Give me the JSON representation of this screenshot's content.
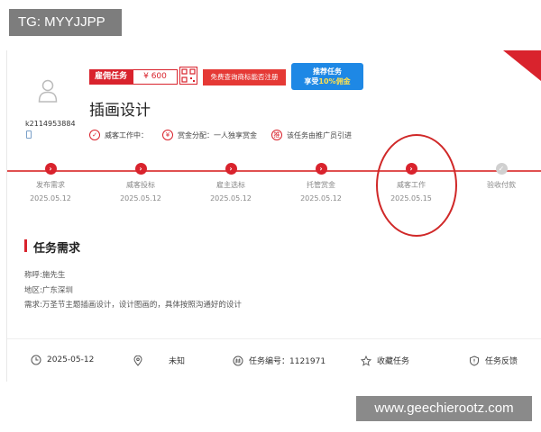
{
  "watermark": {
    "tag": "TG: MYYJJPP",
    "url": "www.geechierootz.com"
  },
  "user": {
    "id": "k2114953884"
  },
  "task": {
    "type_badge": "雇佣任务",
    "price": "¥ 600",
    "query_button": "免费查询商标能否注册",
    "promo_line1": "推荐任务",
    "promo_line2_pre": "享受",
    "promo_line2_hl": "10%佣金",
    "title": "插画设计",
    "meta": [
      {
        "icon": "check-circle-icon",
        "label": "威客工作中："
      },
      {
        "icon": "yen-circle-icon",
        "label": "赏金分配：一人独享赏金"
      },
      {
        "icon": "promoter-icon",
        "label": "该任务由推广员引进"
      }
    ]
  },
  "progress": {
    "steps": [
      {
        "label": "发布需求",
        "date": "2025.05.12",
        "done": true
      },
      {
        "label": "威客投标",
        "date": "2025.05.12",
        "done": true
      },
      {
        "label": "雇主选标",
        "date": "2025.05.12",
        "done": true
      },
      {
        "label": "托管赏金",
        "date": "2025.05.12",
        "done": true
      },
      {
        "label": "威客工作",
        "date": "2025.05.15",
        "done": true
      },
      {
        "label": "验收付款",
        "date": "",
        "done": false
      }
    ],
    "highlighted_step": 4
  },
  "requirements": {
    "title": "任务需求",
    "lines": [
      "称呼:施先生",
      "地区:广东深圳",
      "需求:万圣节主题插画设计，设计图画的，具体按照沟通好的设计"
    ]
  },
  "footer": {
    "date": "2025-05-12",
    "location": "未知",
    "task_number": "任务编号：1121971",
    "favorite": "收藏任务",
    "feedback": "任务反馈"
  },
  "colors": {
    "accent": "#d9232d",
    "promo": "#1e88e5"
  }
}
